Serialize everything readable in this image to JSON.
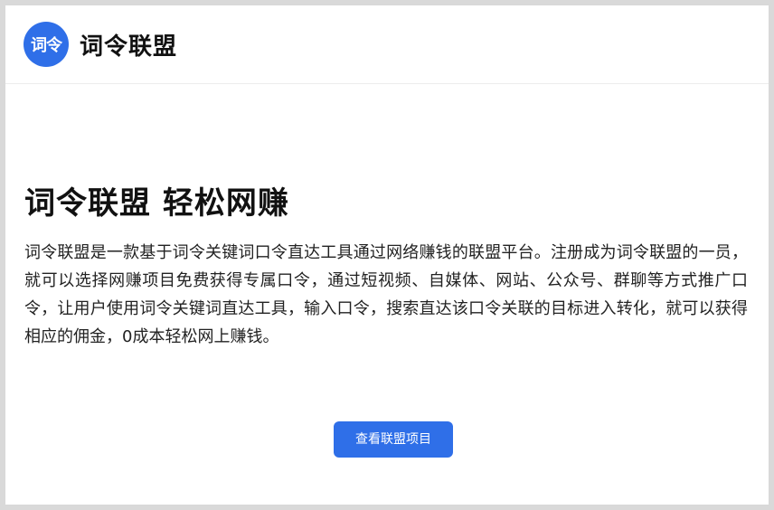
{
  "header": {
    "logo_text": "词令",
    "brand_name": "词令联盟"
  },
  "hero": {
    "title": "词令联盟 轻松网赚",
    "description": "词令联盟是一款基于词令关键词口令直达工具通过网络赚钱的联盟平台。注册成为词令联盟的一员，就可以选择网赚项目免费获得专属口令，通过短视频、自媒体、网站、公众号、群聊等方式推广口令，让用户使用词令关键词直达工具，输入口令，搜索直达该口令关联的目标进入转化，就可以获得相应的佣金，0成本轻松网上赚钱。",
    "cta_label": "查看联盟项目"
  },
  "colors": {
    "brand": "#2f6fe8",
    "background": "#ffffff",
    "frame": "#d9d9d9"
  }
}
